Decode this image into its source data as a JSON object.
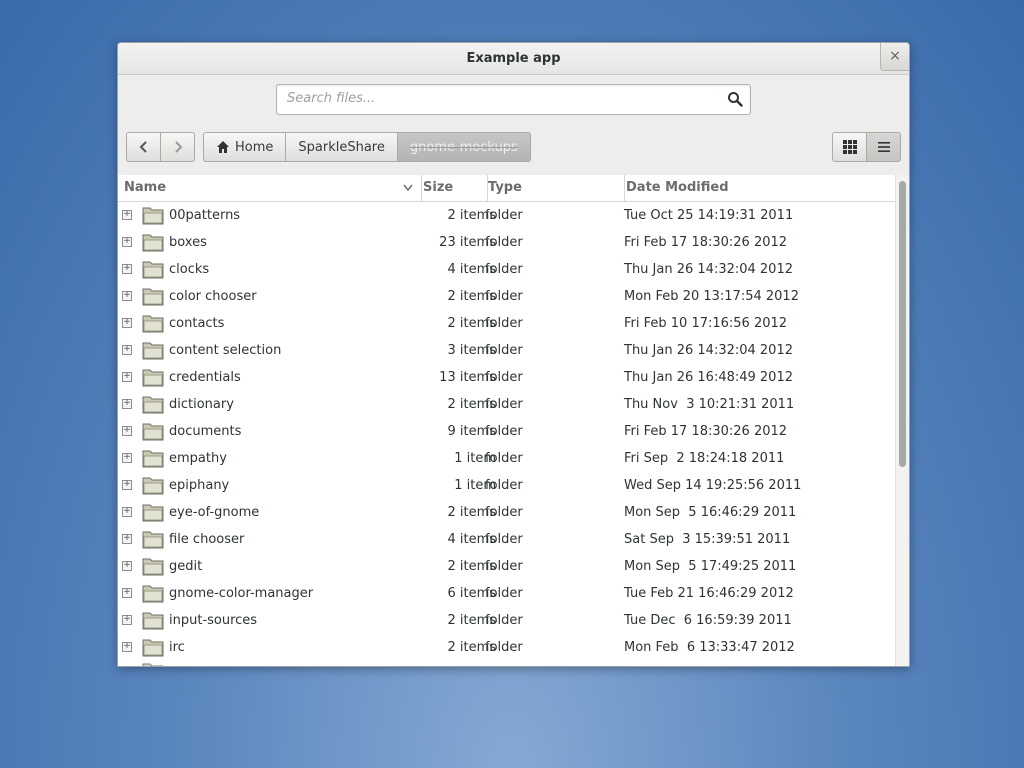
{
  "window": {
    "title": "Example app",
    "close_label": "×"
  },
  "search": {
    "placeholder": "Search files...",
    "icon": "search-icon"
  },
  "nav": {
    "back_icon": "chevron-left-icon",
    "forward_icon": "chevron-right-icon"
  },
  "breadcrumbs": [
    {
      "label": "Home",
      "icon": "home-icon"
    },
    {
      "label": "SparkleShare"
    },
    {
      "label": "gnome-mockups",
      "active": true
    }
  ],
  "view": {
    "grid_icon": "grid-view-icon",
    "list_icon": "list-view-icon",
    "selected": "list"
  },
  "columns": {
    "name": "Name",
    "size": "Size",
    "type": "Type",
    "date": "Date Modified"
  },
  "files": [
    {
      "name": "00patterns",
      "size": "2 items",
      "type": "folder",
      "date": "Tue Oct 25 14:19:31 2011"
    },
    {
      "name": "boxes",
      "size": "23 items",
      "type": "folder",
      "date": "Fri Feb 17 18:30:26 2012"
    },
    {
      "name": "clocks",
      "size": "4 items",
      "type": "folder",
      "date": "Thu Jan 26 14:32:04 2012"
    },
    {
      "name": "color chooser",
      "size": "2 items",
      "type": "folder",
      "date": "Mon Feb 20 13:17:54 2012"
    },
    {
      "name": "contacts",
      "size": "2 items",
      "type": "folder",
      "date": "Fri Feb 10 17:16:56 2012"
    },
    {
      "name": "content selection",
      "size": "3 items",
      "type": "folder",
      "date": "Thu Jan 26 14:32:04 2012"
    },
    {
      "name": "credentials",
      "size": "13 items",
      "type": "folder",
      "date": "Thu Jan 26 16:48:49 2012"
    },
    {
      "name": "dictionary",
      "size": "2 items",
      "type": "folder",
      "date": "Thu Nov  3 10:21:31 2011"
    },
    {
      "name": "documents",
      "size": "9 items",
      "type": "folder",
      "date": "Fri Feb 17 18:30:26 2012"
    },
    {
      "name": "empathy",
      "size": "1 item",
      "type": "folder",
      "date": "Fri Sep  2 18:24:18 2011"
    },
    {
      "name": "epiphany",
      "size": "1 item",
      "type": "folder",
      "date": "Wed Sep 14 19:25:56 2011"
    },
    {
      "name": "eye-of-gnome",
      "size": "2 items",
      "type": "folder",
      "date": "Mon Sep  5 16:46:29 2011"
    },
    {
      "name": "file chooser",
      "size": "4 items",
      "type": "folder",
      "date": "Sat Sep  3 15:39:51 2011"
    },
    {
      "name": "gedit",
      "size": "2 items",
      "type": "folder",
      "date": "Mon Sep  5 17:49:25 2011"
    },
    {
      "name": "gnome-color-manager",
      "size": "6 items",
      "type": "folder",
      "date": "Tue Feb 21 16:46:29 2012"
    },
    {
      "name": "input-sources",
      "size": "2 items",
      "type": "folder",
      "date": "Tue Dec  6 16:59:39 2011"
    },
    {
      "name": "irc",
      "size": "2 items",
      "type": "folder",
      "date": "Mon Feb  6 13:33:47 2012"
    }
  ]
}
